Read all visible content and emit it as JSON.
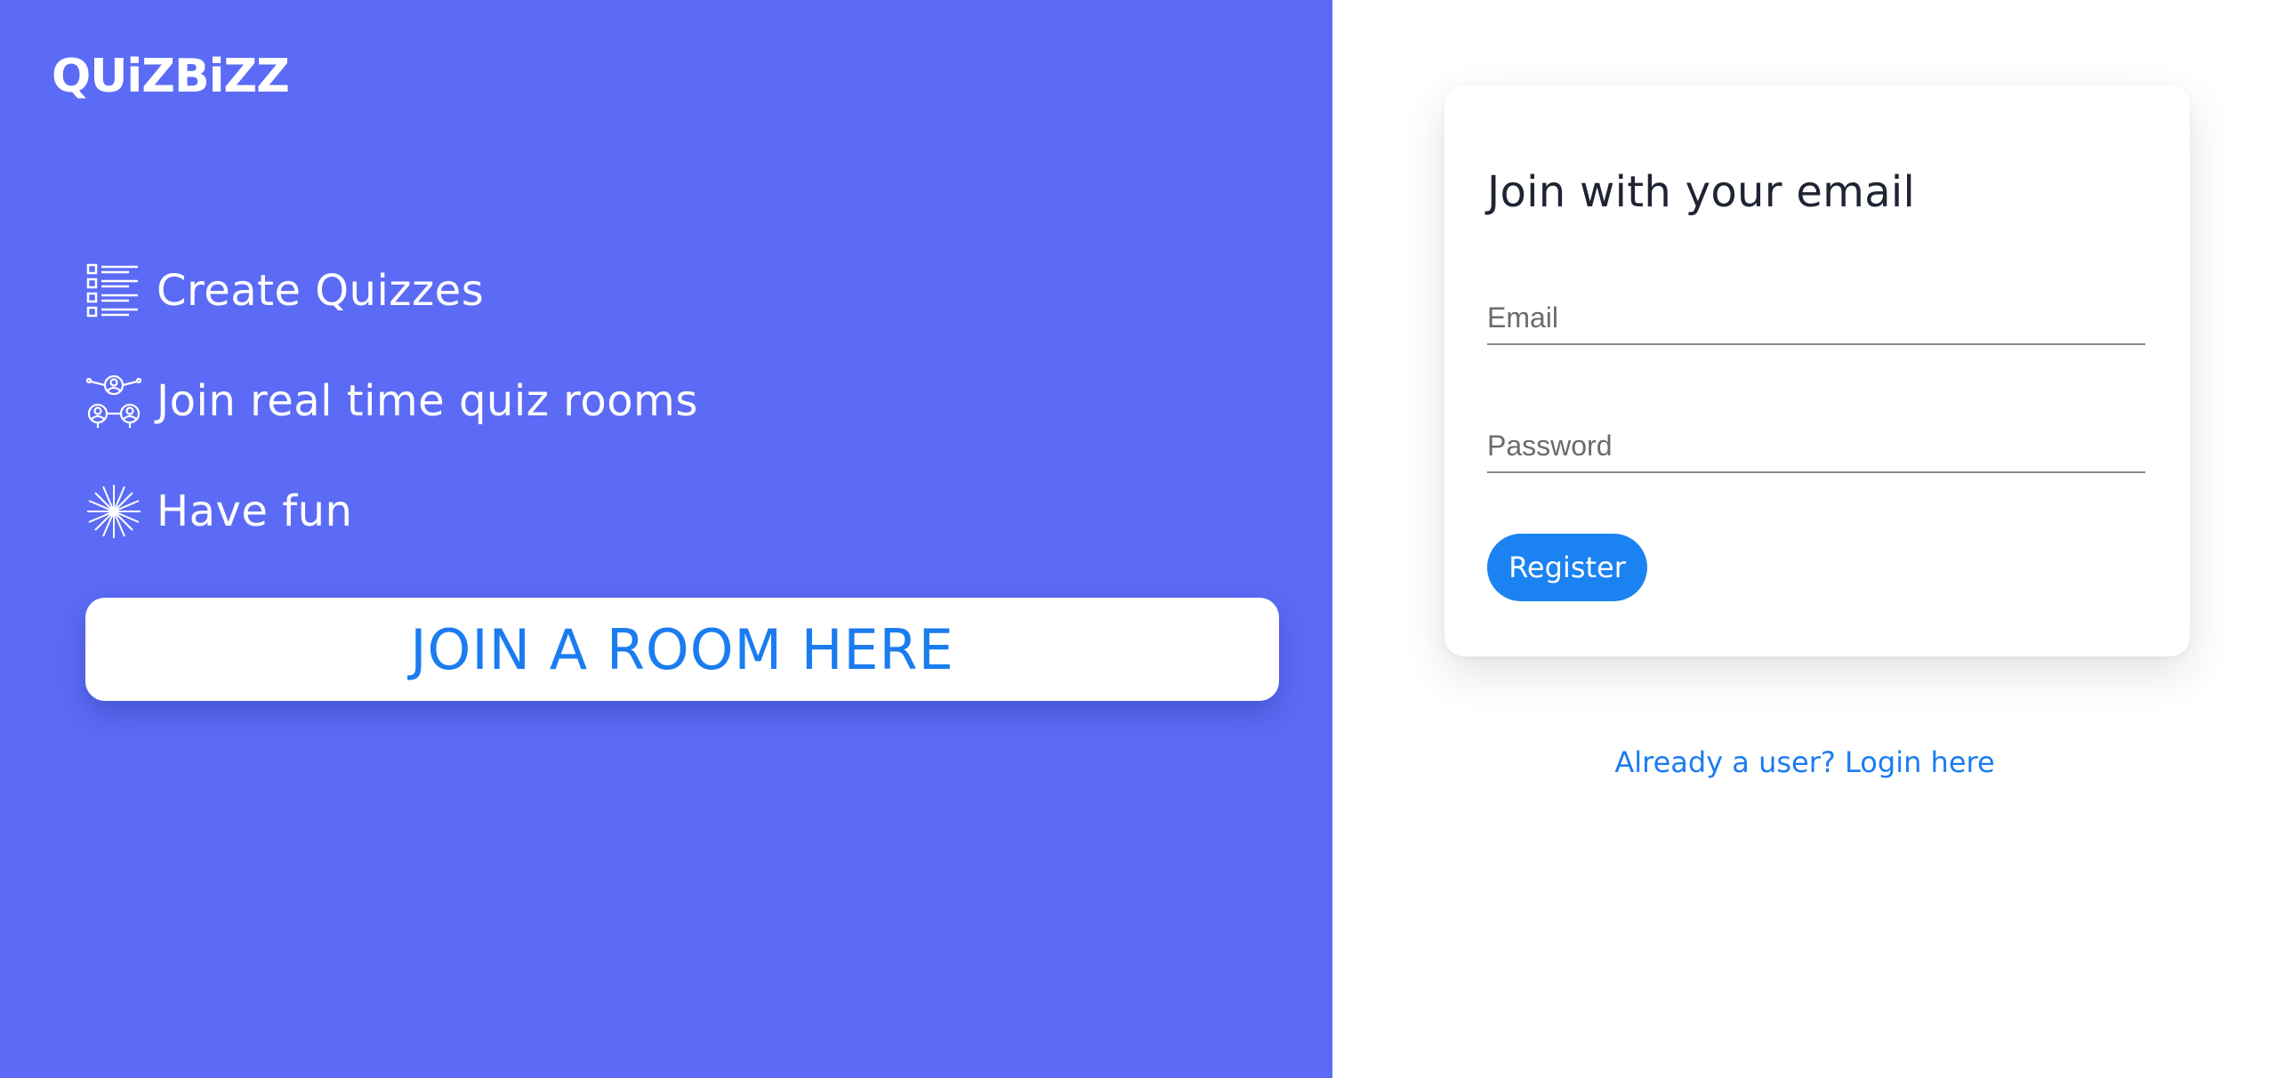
{
  "brand": {
    "logo_text": "QUiZBiZZ"
  },
  "features": [
    {
      "icon": "checklist-icon",
      "label": "Create Quizzes"
    },
    {
      "icon": "people-network-icon",
      "label": "Join real time quiz rooms"
    },
    {
      "icon": "firework-icon",
      "label": "Have fun"
    }
  ],
  "join_room_button": {
    "label": "JOIN A ROOM HERE"
  },
  "signup_card": {
    "title": "Join with your email",
    "email": {
      "placeholder": "Email",
      "value": ""
    },
    "password": {
      "placeholder": "Password",
      "value": ""
    },
    "register_label": "Register"
  },
  "login_link": {
    "label": "Already a user? Login here"
  },
  "colors": {
    "left_panel_bg": "#5b6bf5",
    "accent_blue": "#1b82f1",
    "link_blue": "#1b7cf0",
    "white": "#ffffff"
  }
}
